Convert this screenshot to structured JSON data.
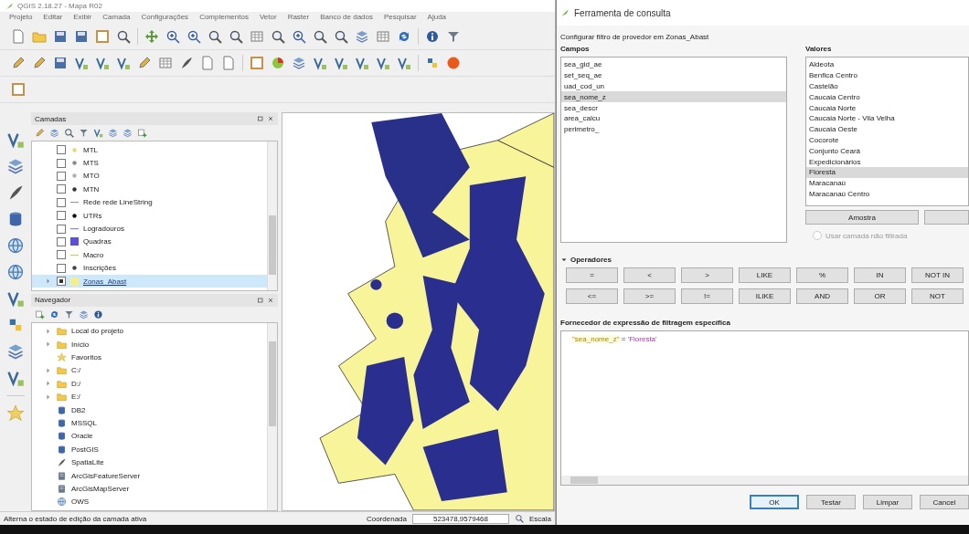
{
  "window": {
    "title": "QGIS 2.18.27 - Mapa R02"
  },
  "menu": [
    "Projeto",
    "Editar",
    "Exibir",
    "Camada",
    "Configurações",
    "Complementos",
    "Vetor",
    "Raster",
    "Banco de dados",
    "Pesquisar",
    "Ajuda"
  ],
  "layers_panel": {
    "title": "Camadas",
    "items": [
      {
        "label": "MTL",
        "kind": "point",
        "color": "#e8d870",
        "checked": false,
        "selected": false
      },
      {
        "label": "MTS",
        "kind": "point",
        "color": "#8a8a8a",
        "checked": false,
        "selected": false
      },
      {
        "label": "MTO",
        "kind": "point",
        "color": "#b0b0b0",
        "checked": false,
        "selected": false
      },
      {
        "label": "MTN",
        "kind": "point",
        "color": "#333333",
        "checked": false,
        "selected": false
      },
      {
        "label": "Rede rede LineString",
        "kind": "line",
        "color": "#9a9a9a",
        "checked": false,
        "selected": false
      },
      {
        "label": "UTRs",
        "kind": "point",
        "color": "#111111",
        "checked": false,
        "selected": false
      },
      {
        "label": "Logradouros",
        "kind": "line",
        "color": "#8a86d8",
        "checked": false,
        "selected": false
      },
      {
        "label": "Quadras",
        "kind": "polygon",
        "color": "#5b4fd6",
        "checked": false,
        "selected": false
      },
      {
        "label": "Macro",
        "kind": "line",
        "color": "#d8c860",
        "checked": false,
        "selected": false
      },
      {
        "label": "Inscrições",
        "kind": "point",
        "color": "#444444",
        "checked": false,
        "selected": false
      },
      {
        "label": "Zonas_Abast",
        "kind": "polygon",
        "color": "#f3ef8c",
        "checked": true,
        "selected": true,
        "expanded": false
      }
    ]
  },
  "browser_panel": {
    "title": "Navegador",
    "items": [
      {
        "label": "Local do projeto",
        "kind": "folder",
        "expanded": false
      },
      {
        "label": "Início",
        "kind": "folder",
        "expanded": false
      },
      {
        "label": "Favoritos",
        "kind": "favorites"
      },
      {
        "label": "C:/",
        "kind": "folder",
        "expanded": false
      },
      {
        "label": "D:/",
        "kind": "folder",
        "expanded": false
      },
      {
        "label": "E:/",
        "kind": "folder",
        "expanded": false
      },
      {
        "label": "DB2",
        "kind": "database"
      },
      {
        "label": "MSSQL",
        "kind": "database"
      },
      {
        "label": "Oracle",
        "kind": "database"
      },
      {
        "label": "PostGIS",
        "kind": "database"
      },
      {
        "label": "SpatiaLite",
        "kind": "feather"
      },
      {
        "label": "ArcGisFeatureServer",
        "kind": "server"
      },
      {
        "label": "ArcGisMapServer",
        "kind": "server"
      },
      {
        "label": "OWS",
        "kind": "globe"
      }
    ]
  },
  "status_bar": {
    "message": "Alterna o estado de edição da camada ativa",
    "coordinate_label": "Coordenada",
    "coordinate": "523478,9579468",
    "scale_label": "Escala"
  },
  "dialog": {
    "title": "Ferramenta de consulta",
    "subtitle": "Configurar filtro de provedor em Zonas_Abast",
    "fields_label": "Campos",
    "fields": [
      {
        "label": "sea_gid_ae",
        "selected": false
      },
      {
        "label": "set_seq_ae",
        "selected": false
      },
      {
        "label": "uad_cod_un",
        "selected": false
      },
      {
        "label": "sea_nome_z",
        "selected": true
      },
      {
        "label": "sea_descr",
        "selected": false
      },
      {
        "label": "area_calcu",
        "selected": false
      },
      {
        "label": "perimetro_",
        "selected": false
      }
    ],
    "values_label": "Valores",
    "values": [
      {
        "label": "Aldeota",
        "selected": false
      },
      {
        "label": "Benfica Centro",
        "selected": false
      },
      {
        "label": "Castelão",
        "selected": false
      },
      {
        "label": "Caucaia Centro",
        "selected": false
      },
      {
        "label": "Caucaia Norte",
        "selected": false
      },
      {
        "label": "Caucaia Norte - Vila Velha",
        "selected": false
      },
      {
        "label": "Caucaia Oeste",
        "selected": false
      },
      {
        "label": "Cocorote",
        "selected": false
      },
      {
        "label": "Conjunto Ceará",
        "selected": false
      },
      {
        "label": "Expedicionários",
        "selected": false
      },
      {
        "label": "Floresta",
        "selected": true
      },
      {
        "label": "Maracanaú",
        "selected": false
      },
      {
        "label": "Maracanaú Centro",
        "selected": false
      }
    ],
    "sample_button": "Amostra",
    "unfiltered": {
      "label": "Usar camada não filtrada",
      "checked": false,
      "disabled": true
    },
    "operators_label": "Operadores",
    "operators_expanded": true,
    "operators": [
      "=",
      "<",
      ">",
      "LIKE",
      "%",
      "IN",
      "NOT IN",
      "<=",
      ">=",
      "!=",
      "ILIKE",
      "AND",
      "OR",
      "NOT"
    ],
    "expression_label": "Fornecedor de expressão de filtragem específica",
    "expression": [
      {
        "kind": "field",
        "text": "\"sea_nome_z\""
      },
      {
        "kind": "operator",
        "text": "="
      },
      {
        "kind": "string",
        "text": "'Floresta'"
      }
    ],
    "buttons": [
      {
        "label": "OK",
        "default": true
      },
      {
        "label": "Testar",
        "default": false
      },
      {
        "label": "Limpar",
        "default": false
      },
      {
        "label": "Cancel",
        "default": false
      }
    ]
  }
}
